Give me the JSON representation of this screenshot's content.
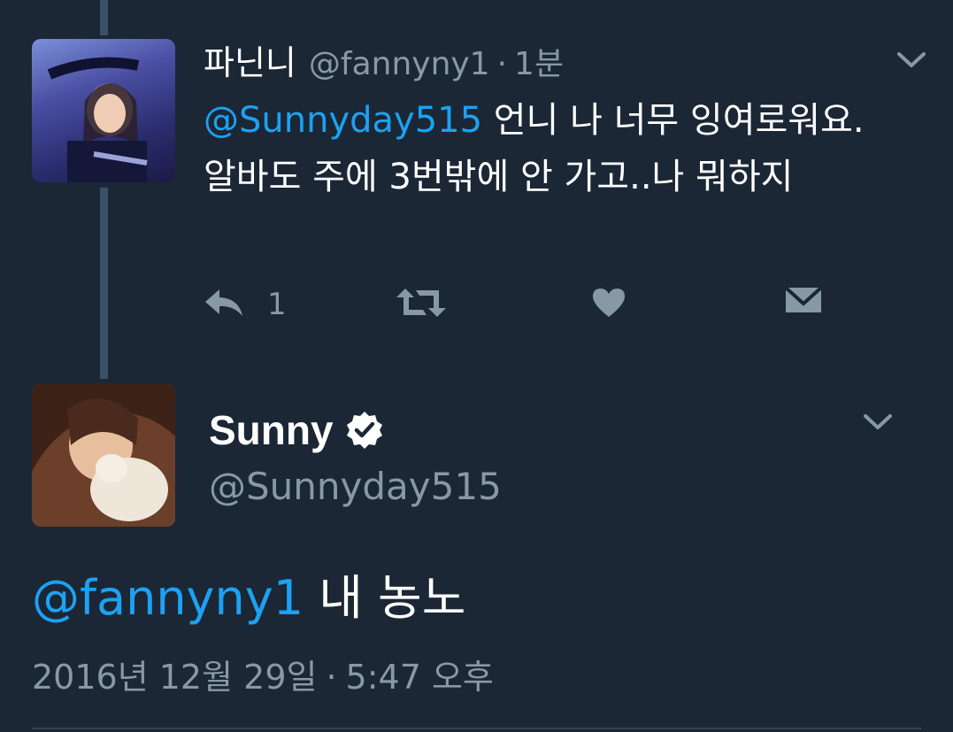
{
  "reply_tweet": {
    "display_name": "파닌니",
    "handle": "@fannyny1",
    "separator": "·",
    "time_ago": "1분",
    "mention": "@Sunnyday515",
    "text": " 언니 나 너무 잉여로워요. 알바도 주에 3번밖에 안 가고..나 뭐하지",
    "reply_count": "1",
    "icons": [
      "reply-icon",
      "retweet-icon",
      "heart-icon",
      "dm-icon",
      "chevron-down-icon"
    ]
  },
  "main_tweet": {
    "display_name": "Sunny",
    "verified": true,
    "handle": "@Sunnyday515",
    "mention": "@fannyny1",
    "text": " 내 농노",
    "date": "2016년 12월 29일",
    "separator": "·",
    "time": "5:47 오후"
  },
  "colors": {
    "background": "#1b2735",
    "mention": "#1da1f2",
    "muted": "#8899a6",
    "text": "#ffffff",
    "thread_line": "#3d5166"
  }
}
